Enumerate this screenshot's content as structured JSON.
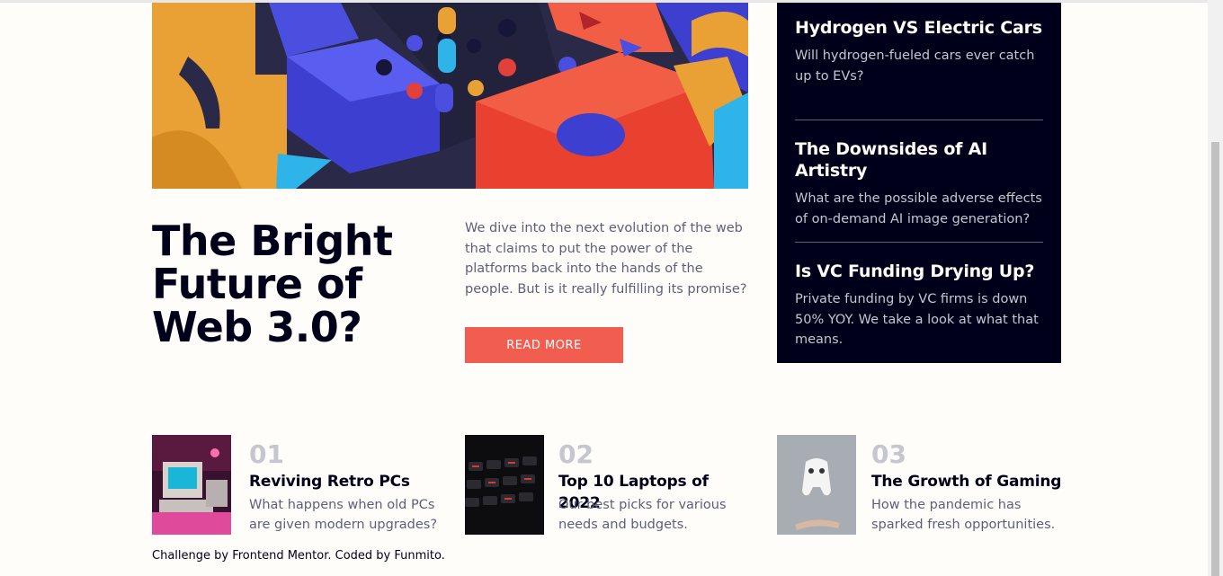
{
  "hero": {
    "title": "The Bright Future of Web 3.0?",
    "description": "We dive into the next evolution of the web that claims to put the power of the platforms back into the hands of the people. But is it really fulfilling its promise?",
    "button_label": "READ MORE"
  },
  "new_panel": {
    "items": [
      {
        "title": "Hydrogen VS Electric Cars",
        "description": "Will hydrogen-fueled cars ever catch up to EVs?"
      },
      {
        "title": "The Downsides of AI Artistry",
        "description": "What are the possible adverse effects of on-demand AI image generation?"
      },
      {
        "title": "Is VC Funding Drying Up?",
        "description": "Private funding by VC firms is down 50% YOY. We take a look at what that means."
      }
    ]
  },
  "bottom": {
    "items": [
      {
        "number": "01",
        "title": "Reviving Retro PCs",
        "description": "What happens when old PCs are given modern upgrades?",
        "icon": "retro-pc-image"
      },
      {
        "number": "02",
        "title": "Top 10 Laptops of 2022",
        "description": "Our best picks for various needs and budgets.",
        "icon": "laptop-keyboard-image"
      },
      {
        "number": "03",
        "title": "The Growth of Gaming",
        "description": "How the pandemic has sparked fresh opportunities.",
        "icon": "game-controller-image"
      }
    ]
  },
  "footer": {
    "text": "Challenge by Frontend Mentor. Coded by Funmito."
  },
  "colors": {
    "accent": "#f15e50",
    "dark": "#00001a",
    "muted": "#5d5f79",
    "number": "#c5c6ce"
  }
}
